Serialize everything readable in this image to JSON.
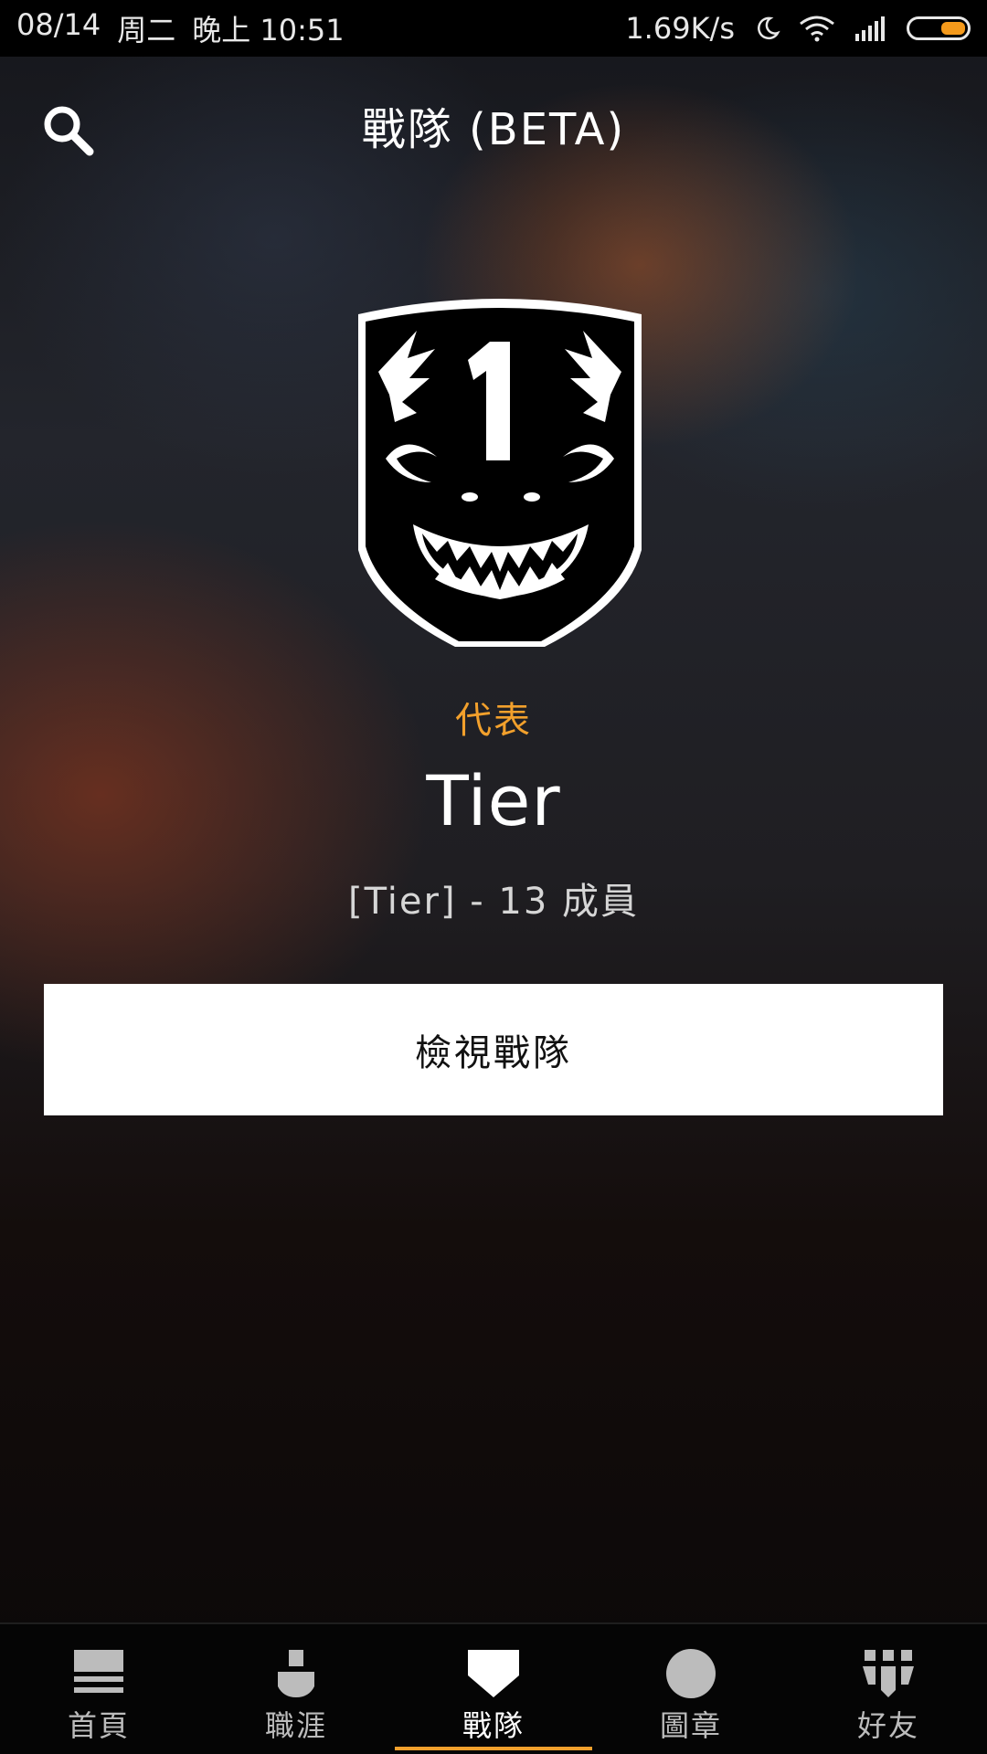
{
  "status_bar": {
    "date": "08/14",
    "weekday": "周二",
    "time": "晚上 10:51",
    "network_speed": "1.69K/s",
    "icons": [
      "moon-icon",
      "wifi-icon",
      "signal-icon",
      "battery-icon"
    ]
  },
  "header": {
    "title": "戰隊 (BETA)",
    "search_icon": "search-icon"
  },
  "platoon": {
    "role": "代表",
    "name": "Tier",
    "info": "[Tier] - 13 成員",
    "emblem_icon": "shark-grin-emblem"
  },
  "actions": {
    "view_button": "檢視戰隊"
  },
  "bottom_nav": {
    "items": [
      {
        "label": "首頁",
        "icon": "home-icon",
        "active": false
      },
      {
        "label": "職涯",
        "icon": "career-icon",
        "active": false
      },
      {
        "label": "戰隊",
        "icon": "platoon-shield-icon",
        "active": true
      },
      {
        "label": "圖章",
        "icon": "emblem-circle-icon",
        "active": false
      },
      {
        "label": "好友",
        "icon": "friends-icon",
        "active": false
      }
    ]
  },
  "colors": {
    "accent": "#f2a02c",
    "battery": "#f59a1b",
    "button_bg": "#ffffff"
  }
}
